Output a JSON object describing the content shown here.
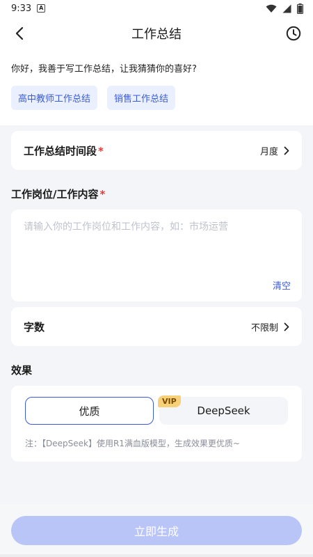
{
  "status_bar": {
    "time": "9:33",
    "notification_icon": "a-icon",
    "icons": [
      "wifi-icon",
      "signal-icon",
      "battery-icon"
    ]
  },
  "header": {
    "title": "工作总结",
    "back_icon": "back-arrow-icon",
    "history_icon": "clock-icon"
  },
  "intro": {
    "greeting": "你好，我善于写工作总结，让我猜猜你的喜好?",
    "chips": [
      "高中教师工作总结",
      "销售工作总结"
    ]
  },
  "period": {
    "label": "工作总结时间段",
    "required_mark": "*",
    "value": "月度"
  },
  "job": {
    "label": "工作岗位/工作内容",
    "required_mark": "*",
    "value": "",
    "placeholder": "请输入你的工作岗位和工作内容，如：市场运营",
    "clear_label": "清空"
  },
  "word_count": {
    "label": "字数",
    "value": "不限制"
  },
  "effect": {
    "title": "效果",
    "options": [
      "优质",
      "DeepSeek"
    ],
    "vip_badge": "VIP",
    "selected": "优质",
    "note": "注：【DeepSeek】使用R1满血版模型，生成效果更优质~"
  },
  "generate_button": "立即生成",
  "colors": {
    "accent": "#3a5bd9",
    "chip_bg": "#eaf0ff",
    "button_disabled": "#b9c5f7",
    "required": "#e53935",
    "vip": "#f7d07a"
  }
}
